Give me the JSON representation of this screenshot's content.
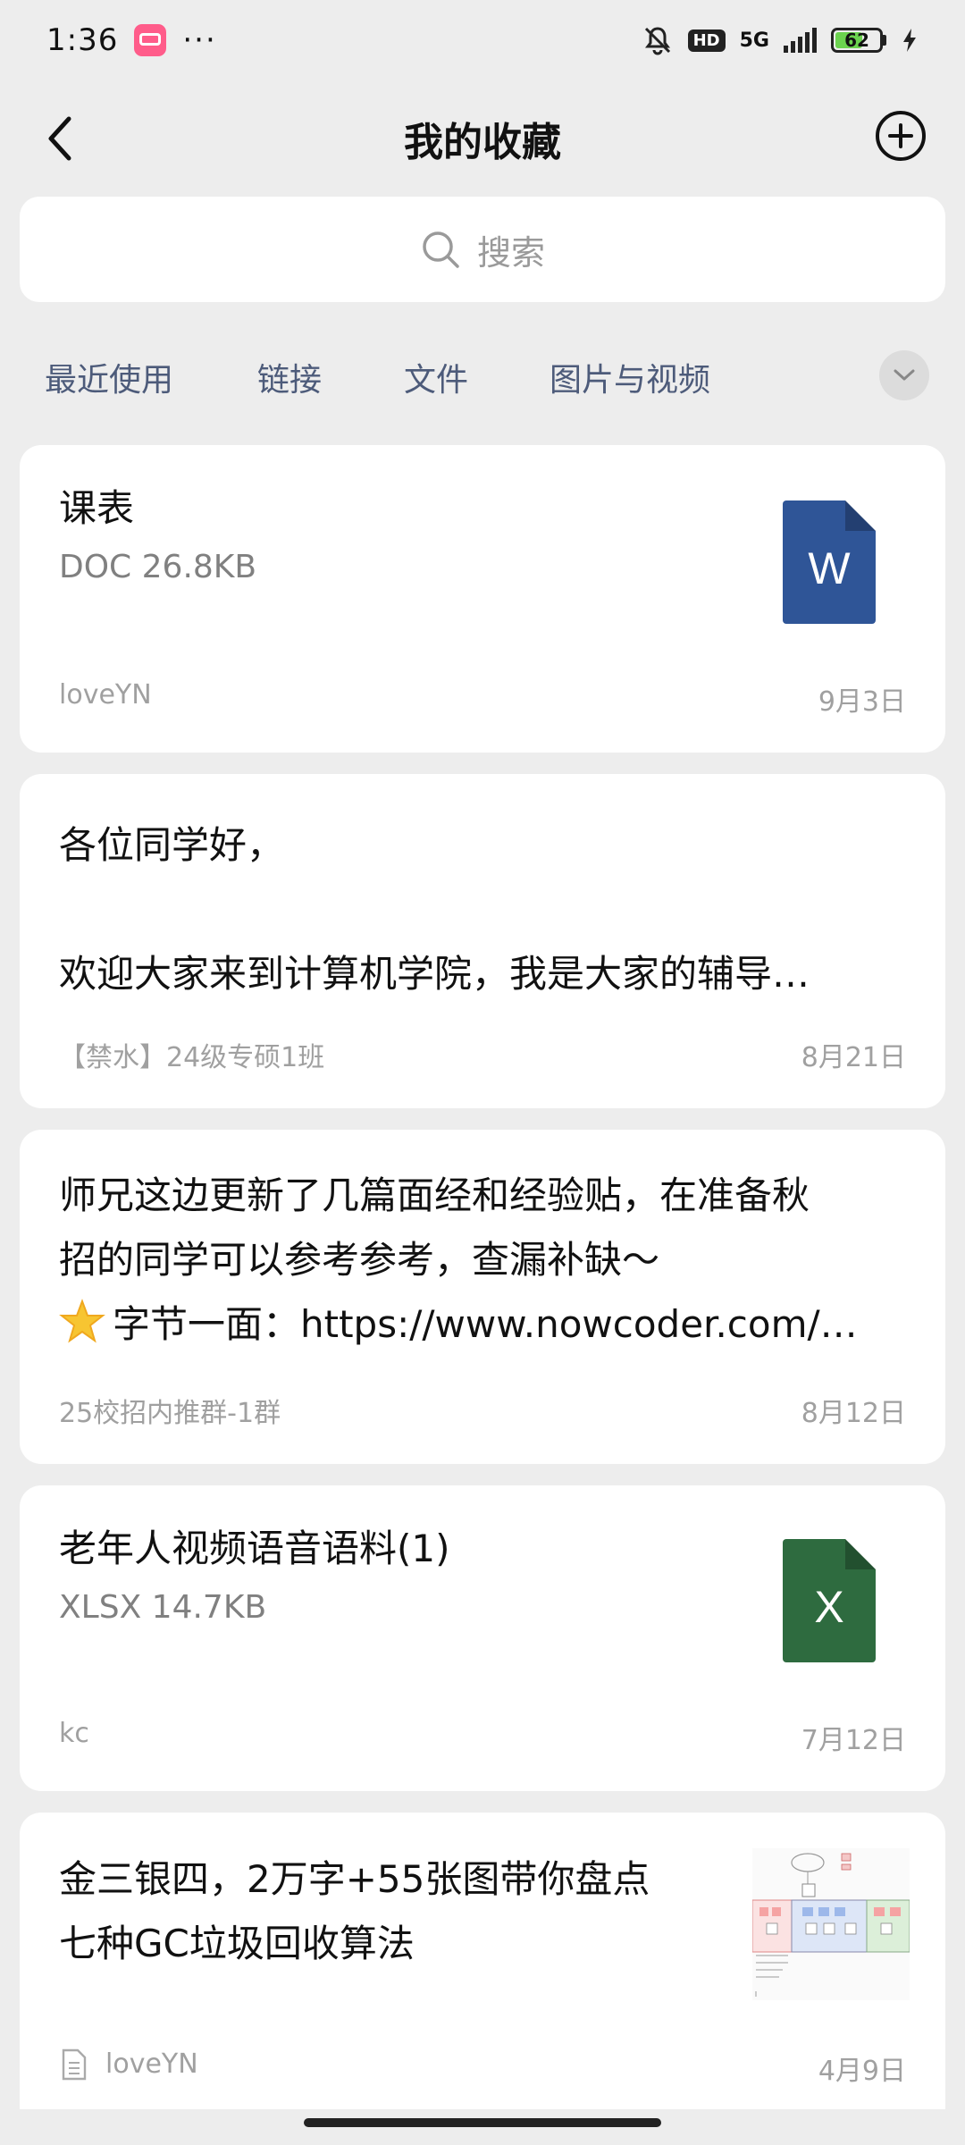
{
  "status_bar": {
    "time": "1:36",
    "dots": "···",
    "hd": "HD",
    "network": "5G",
    "battery": "62",
    "battery_level": 0.62
  },
  "nav": {
    "title": "我的收藏"
  },
  "search": {
    "placeholder": "搜索"
  },
  "tabs": [
    "最近使用",
    "链接",
    "文件",
    "图片与视频"
  ],
  "cards": [
    {
      "title": "课表",
      "subtitle": "DOC 26.8KB",
      "icon_letter": "W",
      "icon_color": "#2f5597",
      "source": "loveYN",
      "date": "9月3日"
    },
    {
      "line1": "各位同学好，",
      "line2": "欢迎大家来到计算机学院，我是大家的辅导…",
      "source": "【禁水】24级专硕1班",
      "date": "8月21日"
    },
    {
      "line1": "师兄这边更新了几篇面经和经验贴，在准备秋",
      "line2": "招的同学可以参考参考，查漏补缺～",
      "line3": "字节一面：https://www.nowcoder.com/…",
      "source": "25校招内推群-1群",
      "date": "8月12日"
    },
    {
      "title": "老年人视频语音语料(1)",
      "subtitle": "XLSX 14.7KB",
      "icon_letter": "X",
      "icon_color": "#2e6b3f",
      "source": "kc",
      "date": "7月12日"
    },
    {
      "line1": "金三银四，2万字+55张图带你盘点",
      "line2": "七种GC垃圾回收算法",
      "source": "loveYN",
      "date": "4月9日"
    }
  ]
}
